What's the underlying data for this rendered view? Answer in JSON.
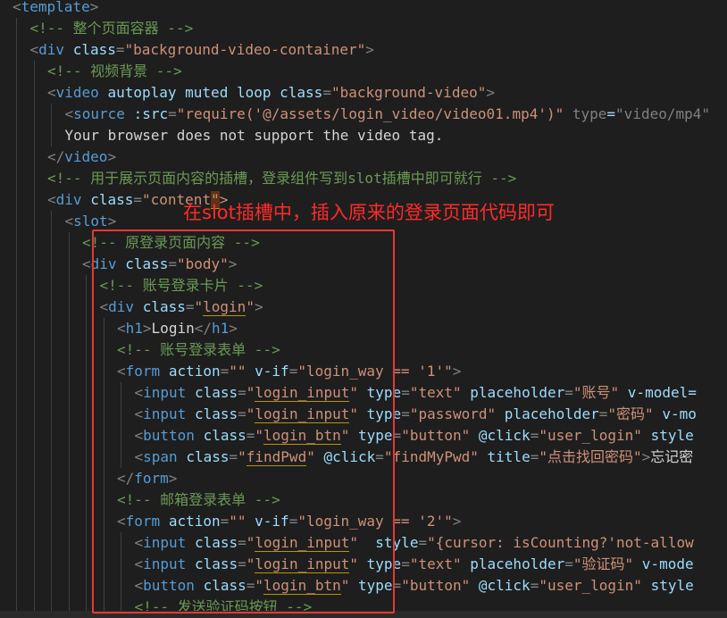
{
  "lines": [
    [
      "<",
      "template",
      ">"
    ],
    [
      "<!-- 整个页面容器 -->"
    ],
    [
      "<",
      "div",
      " ",
      "class",
      "=",
      "\"background-video-container\"",
      ">"
    ],
    [
      "<!-- 视频背景 -->"
    ],
    [
      "<",
      "video",
      " ",
      "autoplay",
      " ",
      "muted",
      " ",
      "loop",
      " ",
      "class",
      "=",
      "\"background-video\"",
      ">"
    ],
    [
      "<",
      "source",
      " ",
      ":src",
      "=",
      "\"require(",
      "'@/assets/login_video/video01.mp4'",
      ")\"",
      " ",
      "type",
      "=",
      "\"video/mp4\""
    ],
    [
      "Your browser does not support the video tag."
    ],
    [
      "</",
      "video",
      ">"
    ],
    [
      "<!-- 用于展示页面内容的插槽，登录组件写到slot插槽中即可就行 -->"
    ],
    [
      "<",
      "div",
      " ",
      "class",
      "=",
      "\"",
      "content",
      "\"",
      ">"
    ],
    [
      "<",
      "slot",
      ">"
    ],
    [
      "<!-- 原登录页面内容 -->"
    ],
    [
      "<",
      "div",
      " ",
      "class",
      "=",
      "\"body\"",
      ">"
    ],
    [
      "<!-- 账号登录卡片 -->"
    ],
    [
      "<",
      "div",
      " ",
      "class",
      "=",
      "\"",
      "login",
      "\"",
      ">"
    ],
    [
      "<",
      "h1",
      ">",
      "Login",
      "</",
      "h1",
      ">"
    ],
    [
      "<!-- 账号登录表单 -->"
    ],
    [
      "<",
      "form",
      " ",
      "action",
      "=",
      "\"\"",
      " ",
      "v-if",
      "=",
      "\"login_way == '1'\"",
      ">"
    ],
    [
      "<",
      "input",
      " ",
      "class",
      "=",
      "\"",
      "login_input",
      "\"",
      " ",
      "type",
      "=",
      "\"text\"",
      " ",
      "placeholder",
      "=",
      "\"账号\"",
      " ",
      "v-model="
    ],
    [
      "<",
      "input",
      " ",
      "class",
      "=",
      "\"",
      "login_input",
      "\"",
      " ",
      "type",
      "=",
      "\"password\"",
      " ",
      "placeholder",
      "=",
      "\"密码\"",
      " ",
      "v-mo"
    ],
    [
      "<",
      "button",
      " ",
      "class",
      "=",
      "\"",
      "login_btn",
      "\"",
      " ",
      "type",
      "=",
      "\"button\"",
      " ",
      "@click",
      "=",
      "\"user_login\"",
      " ",
      "style"
    ],
    [
      "<",
      "span",
      " ",
      "class",
      "=",
      "\"",
      "findPwd",
      "\"",
      " ",
      "@click",
      "=",
      "\"findMyPwd\"",
      " ",
      "title",
      "=",
      "\"点击找回密码\"",
      ">",
      "忘记密"
    ],
    [
      "</",
      "form",
      ">"
    ],
    [
      "<!-- 邮箱登录表单 -->"
    ],
    [
      "<",
      "form",
      " ",
      "action",
      "=",
      "\"\"",
      " ",
      "v-if",
      "=",
      "\"login_way == '2'\"",
      ">"
    ],
    [
      "<",
      "input",
      " ",
      "class",
      "=",
      "\"",
      "login_input",
      "\"",
      "  ",
      "style",
      "=",
      "\"{cursor: isCounting?'not-allow"
    ],
    [
      "<",
      "input",
      " ",
      "class",
      "=",
      "\"",
      "login_input",
      "\"",
      " ",
      "type",
      "=",
      "\"text\"",
      " ",
      "placeholder",
      "=",
      "\"验证码\"",
      " ",
      "v-mode"
    ],
    [
      "<",
      "button",
      " ",
      "class",
      "=",
      "\"",
      "login_btn",
      "\"",
      " ",
      "type",
      "=",
      "\"button\"",
      " ",
      "@click",
      "=",
      "\"user_login\"",
      " ",
      "style"
    ],
    [
      "<!-- 发送验证码按钮 -->"
    ]
  ],
  "annotation": "在slot插槽中，插入原来的登录页面代码即可",
  "colors": {
    "background": "#1e1e1e",
    "tag": "#569cd6",
    "attribute": "#9cdcfe",
    "string": "#ce9178",
    "comment": "#6a9955",
    "punctuation": "#808080",
    "text": "#d4d4d4",
    "annotation_red": "#ff2a2a"
  }
}
